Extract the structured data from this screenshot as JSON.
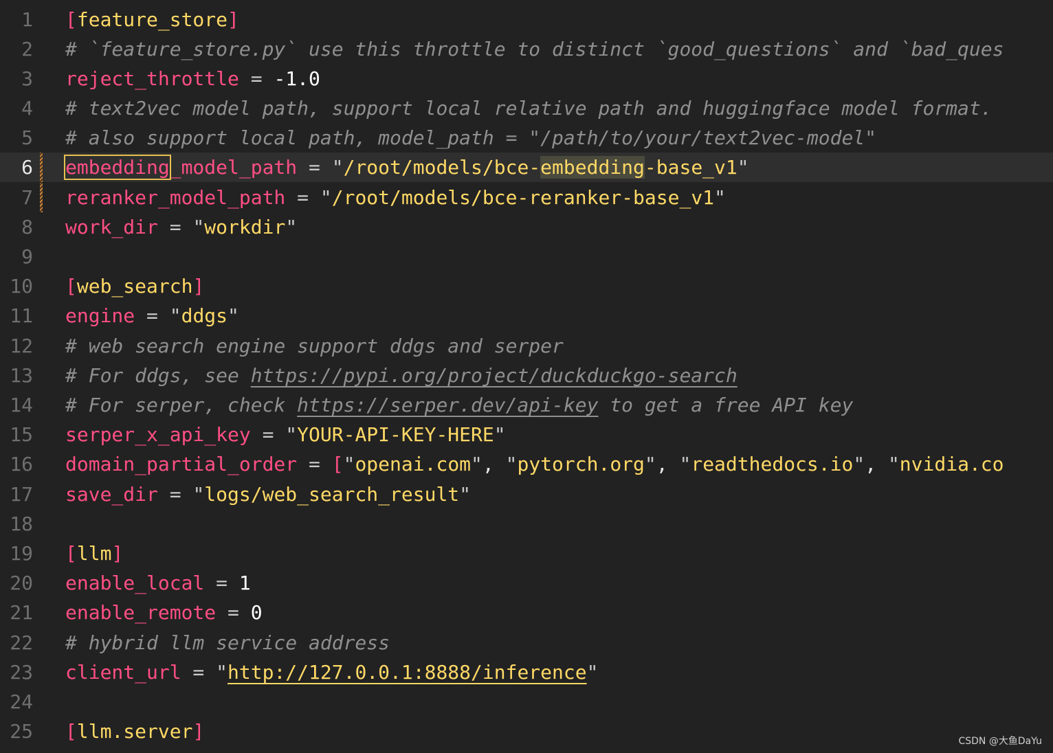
{
  "editor": {
    "line_numbers": [
      "1",
      "2",
      "3",
      "4",
      "5",
      "6",
      "7",
      "8",
      "9",
      "10",
      "11",
      "12",
      "13",
      "14",
      "15",
      "16",
      "17",
      "18",
      "19",
      "20",
      "21",
      "22",
      "23",
      "24",
      "25"
    ],
    "current_line": "6",
    "colors": {
      "background": "#222222",
      "key": "#ff4f84",
      "string": "#ffd966",
      "comment": "#8f8f8f",
      "number": "#ffffff",
      "current_line_bg": "#2f2f2f",
      "modified_marker": "#c9853c"
    },
    "lines": {
      "l1": {
        "section": "feature_store"
      },
      "l2": {
        "comment": "# `feature_store.py` use this throttle to distinct `good_questions` and `bad_ques"
      },
      "l3": {
        "key": "reject_throttle",
        "value": "-1.0"
      },
      "l4": {
        "comment": "# text2vec model path, support local relative path and huggingface model format."
      },
      "l5": {
        "comment": "# also support local path, model_path = \"/path/to/your/text2vec-model\""
      },
      "l6": {
        "key_highlighted": "embedding",
        "key_rest": "_model_path",
        "value_before": "/root/models/bce-",
        "value_highlighted": "embedding",
        "value_after": "-base_v1"
      },
      "l7": {
        "key": "reranker_model_path",
        "value": "/root/models/bce-reranker-base_v1"
      },
      "l8": {
        "key": "work_dir",
        "value": "workdir"
      },
      "l9": {},
      "l10": {
        "section": "web_search"
      },
      "l11": {
        "key": "engine",
        "value": "ddgs"
      },
      "l12": {
        "comment": "# web search engine support ddgs and serper"
      },
      "l13": {
        "comment_before": "# For ddgs, see ",
        "link": "https://pypi.org/project/duckduckgo-search"
      },
      "l14": {
        "comment_before": "# For serper, check ",
        "link": "https://serper.dev/api-key",
        "comment_after": " to get a free API key"
      },
      "l15": {
        "key": "serper_x_api_key",
        "value": "YOUR-API-KEY-HERE"
      },
      "l16": {
        "key": "domain_partial_order",
        "items": [
          "openai.com",
          "pytorch.org",
          "readthedocs.io",
          "nvidia.co"
        ]
      },
      "l17": {
        "key": "save_dir",
        "value": "logs/web_search_result"
      },
      "l18": {},
      "l19": {
        "section": "llm"
      },
      "l20": {
        "key": "enable_local",
        "value": "1"
      },
      "l21": {
        "key": "enable_remote",
        "value": "0"
      },
      "l22": {
        "comment": "# hybrid llm service address"
      },
      "l23": {
        "key": "client_url",
        "value": "http://127.0.0.1:8888/inference"
      },
      "l24": {},
      "l25": {
        "section": "llm.server"
      }
    }
  },
  "watermark": "CSDN @大鱼DaYu"
}
